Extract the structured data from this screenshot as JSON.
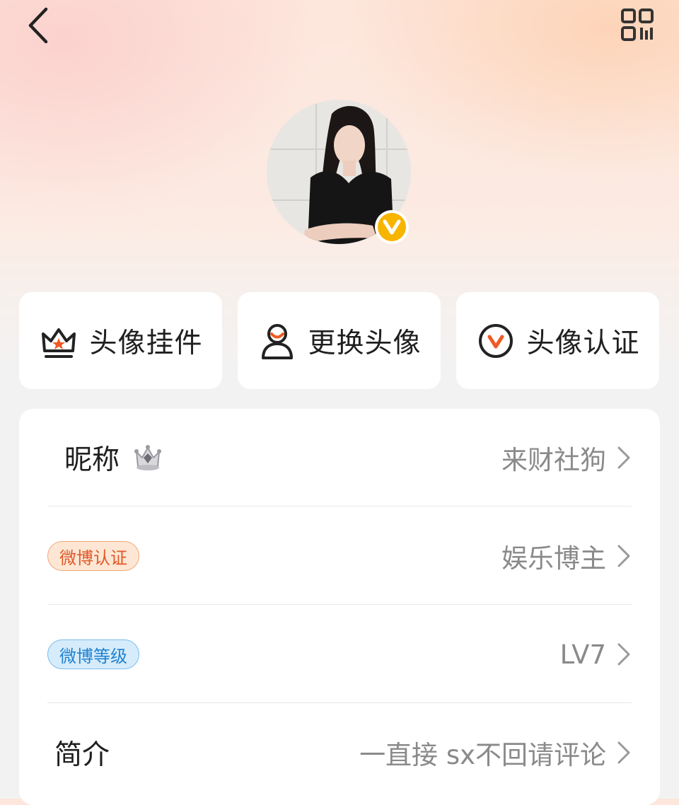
{
  "header": {
    "back_icon": "chevron-left-icon",
    "qr_icon": "qr-code-icon"
  },
  "profile": {
    "verified_badge_letter": "V",
    "badge_color": "#f7b500"
  },
  "quick_actions": [
    {
      "label": "头像挂件",
      "icon": "crown-icon"
    },
    {
      "label": "更换头像",
      "icon": "person-icon"
    },
    {
      "label": "头像认证",
      "icon": "v-verify-icon"
    }
  ],
  "info": {
    "nickname_label": "昵称",
    "nickname_icon": "crown-medal-icon",
    "nickname_value": "来财社狗",
    "verify_tag": "微博认证",
    "verify_value": "娱乐博主",
    "level_tag": "微博等级",
    "level_value": "LV7",
    "bio_label": "简介",
    "bio_value": "一直接 sx不回请评论"
  },
  "colors": {
    "accent_orange": "#ef5a24",
    "verify_yellow": "#f7b500",
    "tag_orange_text": "#e0592a",
    "tag_blue_text": "#1f82d0"
  }
}
